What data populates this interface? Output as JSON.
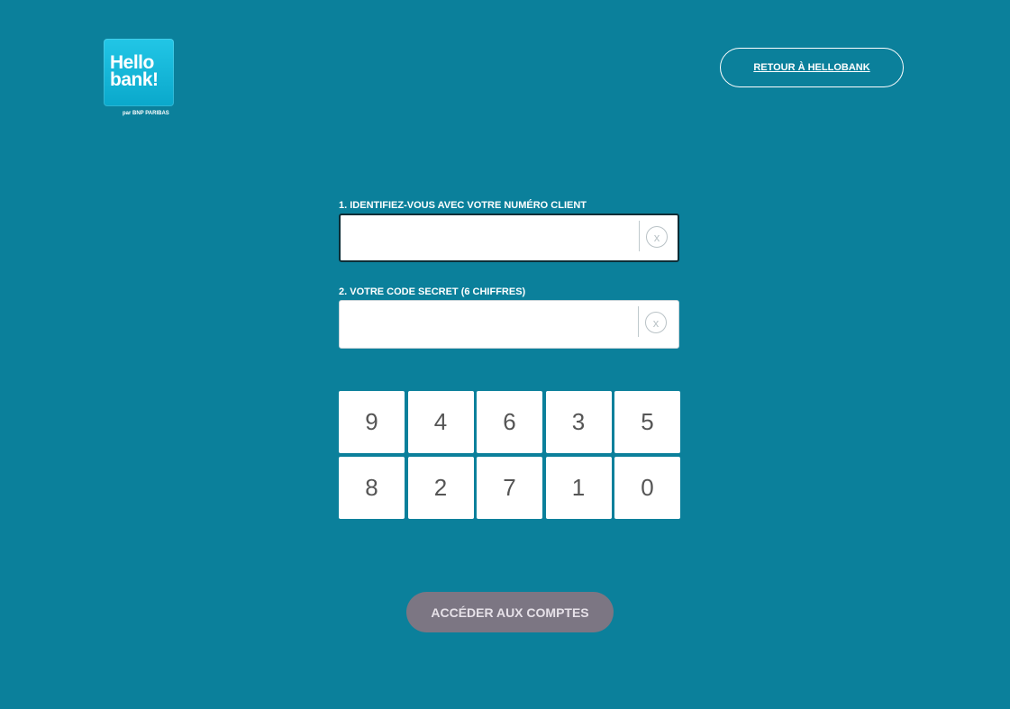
{
  "header": {
    "logo_line1": "Hello",
    "logo_line2": "bank!",
    "logo_sub": "par BNP PARIBAS",
    "retour_label": "RETOUR À HELLOBANK"
  },
  "login": {
    "client_label": "1. IDENTIFIEZ-VOUS AVEC VOTRE NUMÉRO CLIENT",
    "client_value": "",
    "code_label": "2. VOTRE CODE SECRET (6 CHIFFRES)",
    "code_value": "",
    "clear_symbol": "x"
  },
  "keypad": {
    "keys": [
      "9",
      "4",
      "6",
      "3",
      "5",
      "8",
      "2",
      "7",
      "1",
      "0"
    ]
  },
  "submit_label": "ACCÉDER AUX COMPTES",
  "colors": {
    "background": "#0b809b",
    "logo": "#22c6e6",
    "submit": "#7c7683"
  }
}
